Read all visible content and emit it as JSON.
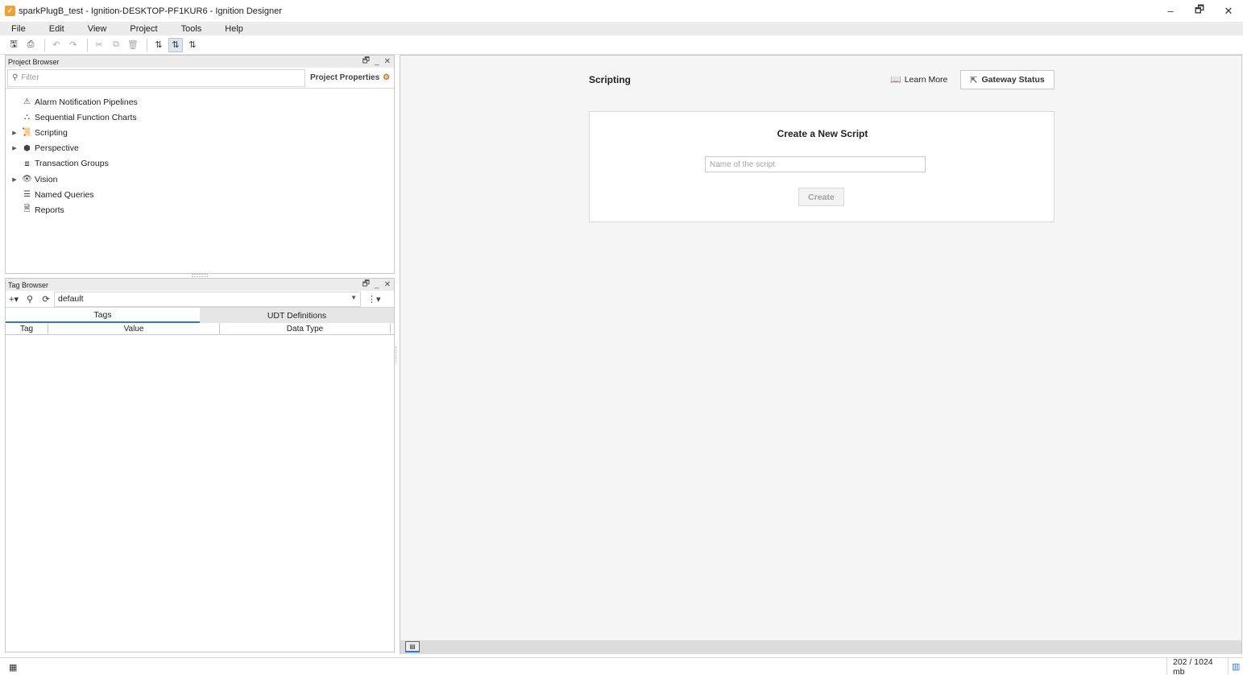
{
  "window": {
    "title": "sparkPlugB_test - Ignition-DESKTOP-PF1KUR6 - Ignition Designer",
    "controls": {
      "minimize": "–",
      "restore": "🗗",
      "close": "✕"
    }
  },
  "menu": [
    "File",
    "Edit",
    "View",
    "Project",
    "Tools",
    "Help"
  ],
  "project_browser": {
    "title": "Project Browser",
    "filter_placeholder": "Filter",
    "properties_label": "Project Properties",
    "items": [
      {
        "label": "Alarm Notification Pipelines",
        "icon": "alarm-pipeline-icon",
        "expandable": false
      },
      {
        "label": "Sequential Function Charts",
        "icon": "sfc-icon",
        "expandable": false
      },
      {
        "label": "Scripting",
        "icon": "scripting-icon",
        "expandable": true
      },
      {
        "label": "Perspective",
        "icon": "perspective-icon",
        "expandable": true
      },
      {
        "label": "Transaction Groups",
        "icon": "transaction-groups-icon",
        "expandable": false
      },
      {
        "label": "Vision",
        "icon": "vision-icon",
        "expandable": true
      },
      {
        "label": "Named Queries",
        "icon": "named-queries-icon",
        "expandable": false
      },
      {
        "label": "Reports",
        "icon": "reports-icon",
        "expandable": false
      }
    ]
  },
  "tag_browser": {
    "title": "Tag Browser",
    "provider": "default",
    "tabs": [
      "Tags",
      "UDT Definitions"
    ],
    "columns": [
      "Tag",
      "Value",
      "Data Type"
    ]
  },
  "workspace": {
    "title": "Scripting",
    "learn_more": "Learn More",
    "gateway_status": "Gateway Status",
    "card": {
      "title": "Create a New Script",
      "input_placeholder": "Name of the script",
      "input_value": "",
      "create_label": "Create"
    }
  },
  "status": {
    "memory": "202 / 1024 mb"
  },
  "colors": {
    "accent": "#2d7ac6",
    "app_icon": "#f0a030"
  }
}
